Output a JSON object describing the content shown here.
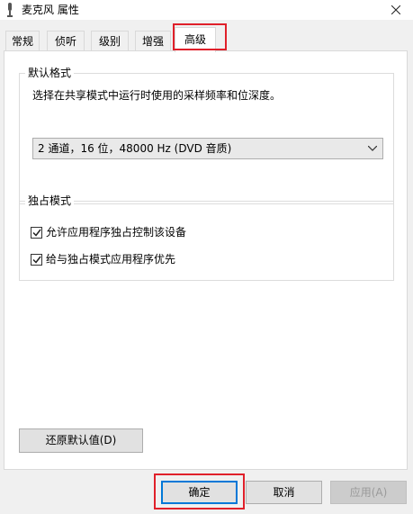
{
  "window": {
    "title": "麦克风 属性",
    "icon": "microphone-icon",
    "close_glyph": "✕"
  },
  "tabs": [
    {
      "label": "常规"
    },
    {
      "label": "侦听"
    },
    {
      "label": "级别"
    },
    {
      "label": "增强"
    },
    {
      "label": "高级",
      "active": true
    }
  ],
  "default_format": {
    "legend": "默认格式",
    "description": "选择在共享模式中运行时使用的采样频率和位深度。",
    "selected_value": "2 通道，16 位，48000 Hz (DVD 音质)"
  },
  "exclusive_mode": {
    "legend": "独占模式",
    "options": [
      {
        "label": "允许应用程序独占控制该设备",
        "checked": true
      },
      {
        "label": "给与独占模式应用程序优先",
        "checked": true
      }
    ]
  },
  "buttons": {
    "restore_defaults": "还原默认值(D)",
    "ok": "确定",
    "cancel": "取消",
    "apply": "应用(A)"
  },
  "colors": {
    "highlight_box": "#e0202a",
    "focus_blue": "#0078d7"
  }
}
